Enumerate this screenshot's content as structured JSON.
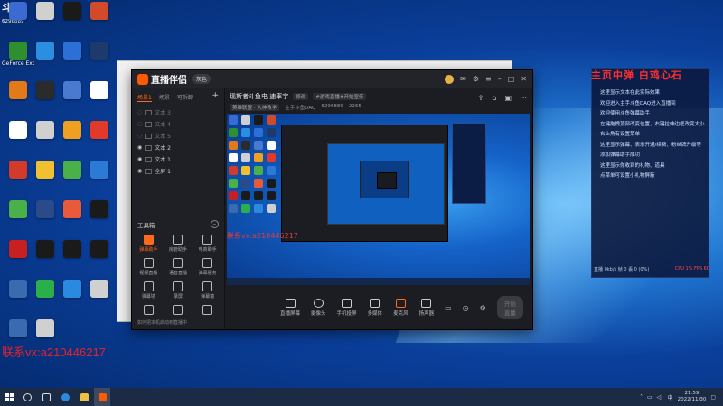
{
  "overlay": {
    "topleft_logo": "斗鱼",
    "topleft_num": "6296889",
    "contact": "联系vx:a210446217"
  },
  "desktop_icons": [
    {
      "label": "",
      "color": "#3b6bd0"
    },
    {
      "label": "",
      "color": "#d0d0d0"
    },
    {
      "label": "",
      "color": "#1a1a1a"
    },
    {
      "label": "",
      "color": "#d14a2a"
    },
    {
      "label": "GeForce Experience",
      "color": "#2f8f2f"
    },
    {
      "label": "",
      "color": "#2a8fe0"
    },
    {
      "label": "",
      "color": "#2c6fd6"
    },
    {
      "label": "",
      "color": "#1e3a6a"
    },
    {
      "label": "",
      "color": "#e27a1a"
    },
    {
      "label": "",
      "color": "#2b2b2b"
    },
    {
      "label": "",
      "color": "#4a7ad0"
    },
    {
      "label": "",
      "color": "#ffffff"
    },
    {
      "label": "",
      "color": "#ffffff"
    },
    {
      "label": "",
      "color": "#d0d0d0"
    },
    {
      "label": "",
      "color": "#f0a020"
    },
    {
      "label": "",
      "color": "#e23a2a"
    },
    {
      "label": "",
      "color": "#d23a2a"
    },
    {
      "label": "",
      "color": "#f0c030"
    },
    {
      "label": "",
      "color": "#4ab04a"
    },
    {
      "label": "",
      "color": "#2a7ad6"
    },
    {
      "label": "",
      "color": "#4ab04a"
    },
    {
      "label": "",
      "color": "#2a4a8a"
    },
    {
      "label": "",
      "color": "#e85a3a"
    },
    {
      "label": "",
      "color": "#1a1a1a"
    },
    {
      "label": "",
      "color": "#c82020"
    },
    {
      "label": "",
      "color": "#1a1a1a"
    },
    {
      "label": "",
      "color": "#1a1a1a"
    },
    {
      "label": "",
      "color": "#1a1a1a"
    },
    {
      "label": "",
      "color": "#3a6ab0"
    },
    {
      "label": "",
      "color": "#2ab04a"
    },
    {
      "label": "",
      "color": "#2a8ae0"
    },
    {
      "label": "",
      "color": "#d0d0d0"
    },
    {
      "label": "",
      "color": "#3a6ab0"
    },
    {
      "label": "",
      "color": "#d0d0d0"
    }
  ],
  "app": {
    "logo": "直播伴侣",
    "badge": "灰色",
    "left_tabs": [
      "场景1",
      "场景",
      "可拆卸"
    ],
    "sources": [
      "文本 3",
      "文本 4",
      "文本 5",
      "文本 2",
      "文本 1",
      "全屏 1"
    ],
    "tools_title": "工具箱",
    "tools": [
      {
        "label": "弹幕助手",
        "hl": true
      },
      {
        "label": "房管助手",
        "hl": false
      },
      {
        "label": "电商助手",
        "hl": false
      },
      {
        "label": "视频直播",
        "hl": false
      },
      {
        "label": "语音直播",
        "hl": false
      },
      {
        "label": "弹幕服务",
        "hl": false
      },
      {
        "label": "弹幕墙",
        "hl": false
      },
      {
        "label": "录屏",
        "hl": false
      },
      {
        "label": "弹幕墙",
        "hl": false
      },
      {
        "label": "",
        "hl": false
      },
      {
        "label": "",
        "hl": false
      },
      {
        "label": "",
        "hl": false
      }
    ],
    "left_footer": "如何把本机启动到直播中",
    "info_title": "现斯者斗鱼电 速率字",
    "info_tags": [
      "修改",
      "#游戏直播#开始宣传"
    ],
    "info_sub": [
      "英雄联盟 · 大神教学",
      "主手斗鱼DAQ",
      "6296889",
      "2265"
    ],
    "bottom_items": [
      "直播屏幕",
      "摄像头",
      "手机投屏",
      "多媒体",
      "麦克风",
      "扬声器"
    ],
    "start_button": "开始直播"
  },
  "chat": {
    "title": "主页中弹 白鸡心石",
    "lines": [
      "这里显示文本在此实际效果",
      "欢迎进入主手斗鱼DAQ进入直播间",
      "欢迎使用斗鱼弹幕助手",
      "左键拖拽顶部改变位置，右键拉伸边框改变大小",
      "右上角有设置菜单",
      "这里显示弹幕、表示开通/续费、粉丝牌升级等",
      "添加弹幕助手成功",
      "这里显示你收到的礼物、道具",
      "点菜单可设置小礼物屏蔽"
    ],
    "footer_left": "直播 0kb/s 帧 0 丢 0 (0%)",
    "footer_right": "CPU 1% FPS 60"
  },
  "taskbar": {
    "time": "21:59",
    "date": "2022/11/30",
    "lang": "中"
  }
}
